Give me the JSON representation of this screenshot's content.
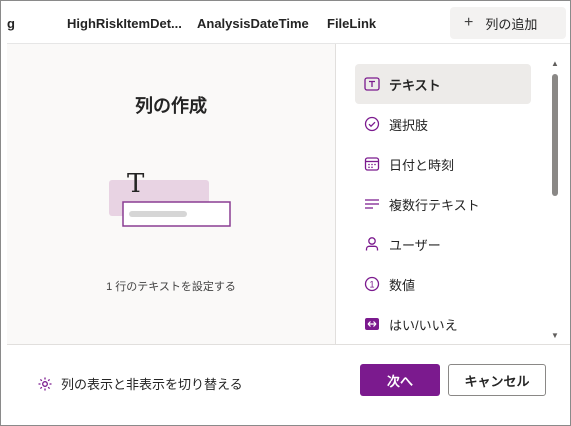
{
  "column_headers": [
    "g",
    "HighRiskItemDet...",
    "AnalysisDateTime",
    "FileLink"
  ],
  "add_column": {
    "label": "列の追加",
    "icon": "plus-icon"
  },
  "left_panel": {
    "title": "列の作成",
    "description": "1 行のテキストを設定する",
    "illustration_glyph": "T"
  },
  "column_types": [
    {
      "label": "テキスト",
      "icon": "text-icon",
      "selected": true
    },
    {
      "label": "選択肢",
      "icon": "check-circle-icon",
      "selected": false
    },
    {
      "label": "日付と時刻",
      "icon": "calendar-icon",
      "selected": false
    },
    {
      "label": "複数行テキスト",
      "icon": "multiline-text-icon",
      "selected": false
    },
    {
      "label": "ユーザー",
      "icon": "person-icon",
      "selected": false
    },
    {
      "label": "数値",
      "icon": "number-circle-icon",
      "number_glyph": "1",
      "selected": false
    },
    {
      "label": "はい/いいえ",
      "icon": "yes-no-toggle-icon",
      "selected": false
    }
  ],
  "footer": {
    "toggle_label": "列の表示と非表示を切り替える",
    "toggle_icon": "gear-icon",
    "next_label": "次へ",
    "cancel_label": "キャンセル"
  },
  "colors": {
    "accent": "#7b1a8e",
    "selected_bg": "#edebe9",
    "illus_pink": "#e8d3e3"
  }
}
